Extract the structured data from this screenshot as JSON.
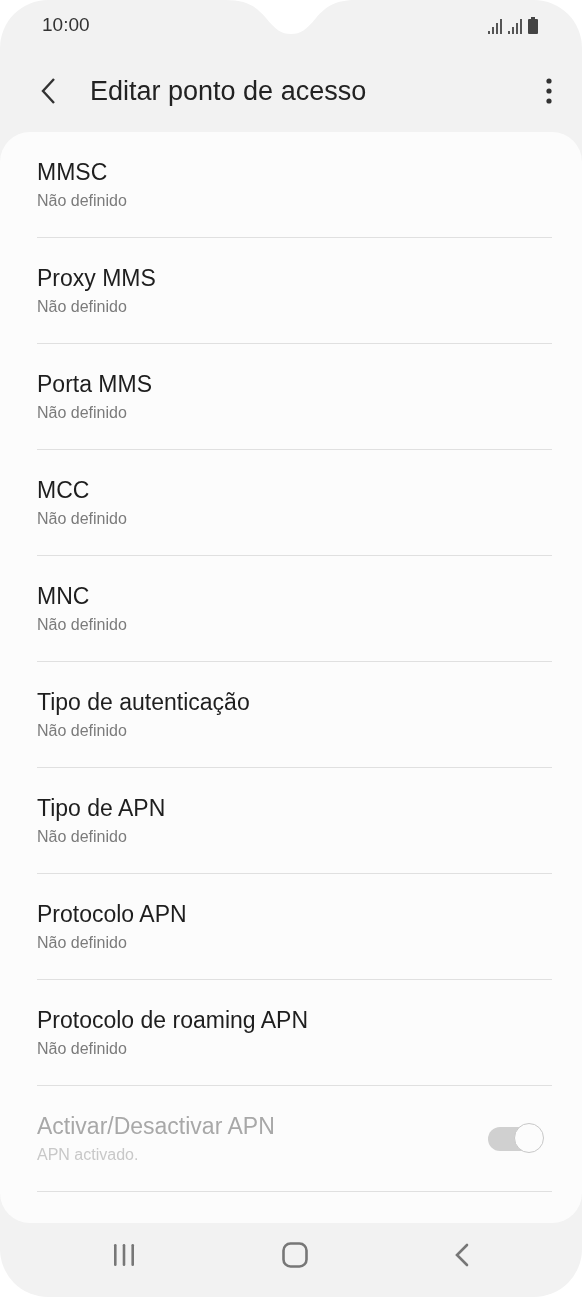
{
  "status_bar": {
    "time": "10:00"
  },
  "header": {
    "title": "Editar ponto de acesso"
  },
  "settings": [
    {
      "kind": "value",
      "title": "MMSC",
      "subtitle": "Não definido"
    },
    {
      "kind": "value",
      "title": "Proxy MMS",
      "subtitle": "Não definido"
    },
    {
      "kind": "value",
      "title": "Porta MMS",
      "subtitle": "Não definido"
    },
    {
      "kind": "value",
      "title": "MCC",
      "subtitle": "Não definido"
    },
    {
      "kind": "value",
      "title": "MNC",
      "subtitle": "Não definido"
    },
    {
      "kind": "value",
      "title": "Tipo de autenticação",
      "subtitle": "Não definido"
    },
    {
      "kind": "value",
      "title": "Tipo de APN",
      "subtitle": "Não definido"
    },
    {
      "kind": "value",
      "title": "Protocolo APN",
      "subtitle": "Não definido"
    },
    {
      "kind": "value",
      "title": "Protocolo de roaming APN",
      "subtitle": "Não definido"
    },
    {
      "kind": "switch",
      "title": "Activar/Desactivar APN",
      "subtitle": "APN activado.",
      "on": true,
      "disabled": true
    }
  ]
}
